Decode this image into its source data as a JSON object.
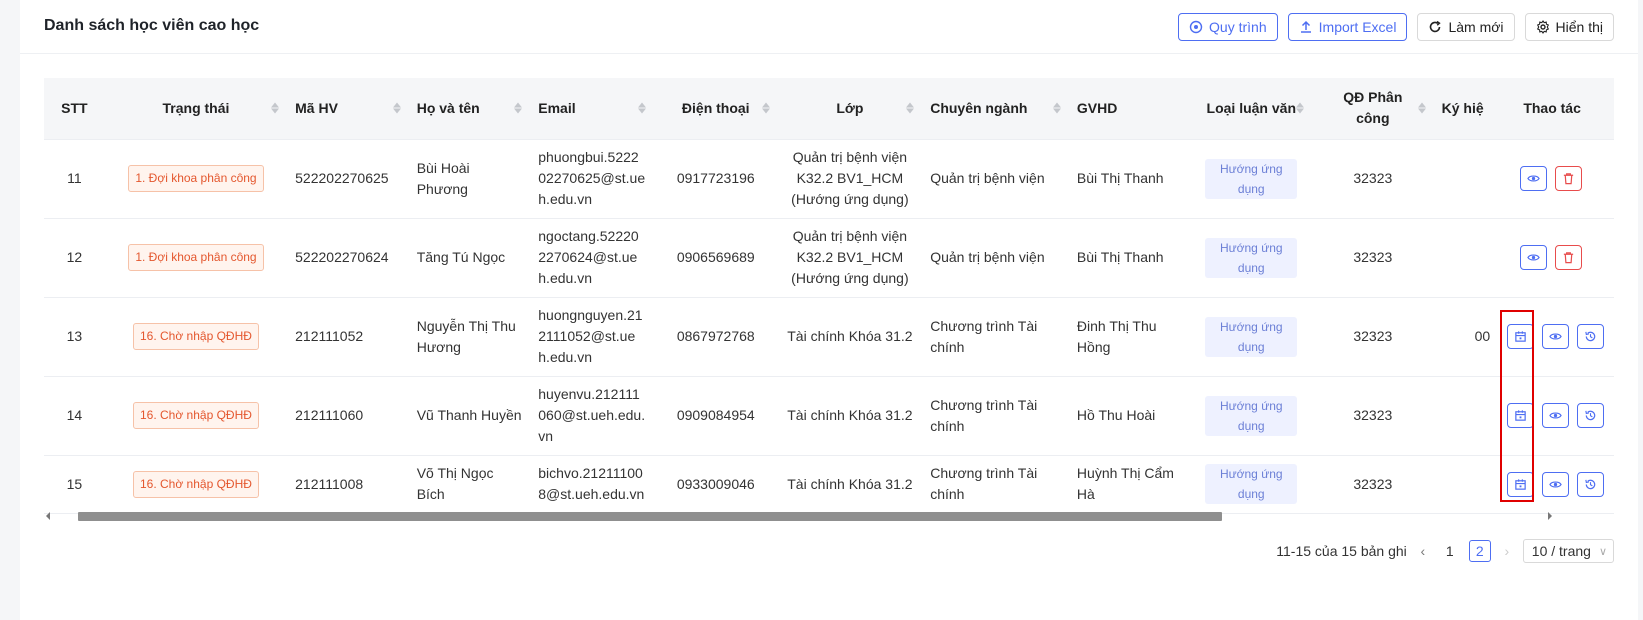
{
  "header": {
    "title": "Danh sách học viên cao học",
    "buttons": {
      "process": "Quy trình",
      "import": "Import Excel",
      "refresh": "Làm mới",
      "display": "Hiển thị"
    }
  },
  "table": {
    "columns": {
      "stt": "STT",
      "status": "Trạng thái",
      "student_id": "Mã HV",
      "name": "Họ và tên",
      "email": "Email",
      "phone": "Điện thoại",
      "class": "Lớp",
      "major": "Chuyên ngành",
      "advisor": "GVHD",
      "thesis_type": "Loại luận văn",
      "decision": "QĐ Phân công",
      "symbol": "Ký hiệ",
      "actions": "Thao tác"
    },
    "rows": [
      {
        "stt": "11",
        "status": "1. Đợi khoa phân công",
        "student_id": "522202270625",
        "name": "Bùi Hoài Phương",
        "email": "phuongbui.522202270625@st.ueh.edu.vn",
        "phone": "0917723196",
        "class": "Quản trị bệnh viện K32.2 BV1_HCM (Hướng ứng dụng)",
        "major": "Quản trị bệnh viện",
        "advisor": "Bùi Thị Thanh",
        "thesis_type": "Hướng ứng dụng",
        "decision": "32323",
        "symbol": "",
        "actions": [
          "view-icon",
          "delete-icon"
        ]
      },
      {
        "stt": "12",
        "status": "1. Đợi khoa phân công",
        "student_id": "522202270624",
        "name": "Tăng Tú Ngọc",
        "email": "ngoctang.522202270624@st.ueh.edu.vn",
        "phone": "0906569689",
        "class": "Quản trị bệnh viện K32.2 BV1_HCM (Hướng ứng dụng)",
        "major": "Quản trị bệnh viện",
        "advisor": "Bùi Thị Thanh",
        "thesis_type": "Hướng ứng dụng",
        "decision": "32323",
        "symbol": "",
        "actions": [
          "view-icon",
          "delete-icon"
        ]
      },
      {
        "stt": "13",
        "status": "16. Chờ nhập QĐHĐ",
        "student_id": "212111052",
        "name": "Nguyễn Thị Thu Hương",
        "email": "huongnguyen.212111052@st.ueh.edu.vn",
        "phone": "0867972768",
        "class": "Tài chính Khóa 31.2",
        "major": "Chương trình Tài chính",
        "advisor": "Đinh Thị Thu Hồng",
        "thesis_type": "Hướng ứng dụng",
        "decision": "32323",
        "symbol": "00",
        "actions": [
          "calendar-icon",
          "view-icon",
          "history-icon"
        ]
      },
      {
        "stt": "14",
        "status": "16. Chờ nhập QĐHĐ",
        "student_id": "212111060",
        "name": "Vũ Thanh Huyền",
        "email": "huyenvu.212111060@st.ueh.edu.vn",
        "phone": "0909084954",
        "class": "Tài chính Khóa 31.2",
        "major": "Chương trình Tài chính",
        "advisor": "Hồ Thu Hoài",
        "thesis_type": "Hướng ứng dụng",
        "decision": "32323",
        "symbol": "",
        "actions": [
          "calendar-icon",
          "view-icon",
          "history-icon"
        ]
      },
      {
        "stt": "15",
        "status": "16. Chờ nhập QĐHĐ",
        "student_id": "212111008",
        "name": "Võ Thị Ngọc Bích",
        "email": "bichvo.212111008@st.ueh.edu.vn",
        "phone": "0933009046",
        "class": "Tài chính Khóa 31.2",
        "major": "Chương trình Tài chính",
        "advisor": "Huỳnh Thị Cẩm Hà",
        "thesis_type": "Hướng ứng dụng",
        "decision": "32323",
        "symbol": "",
        "actions": [
          "calendar-icon",
          "view-icon",
          "history-icon"
        ]
      }
    ]
  },
  "pagination": {
    "summary": "11-15 của 15 bản ghi",
    "pages": [
      "1",
      "2"
    ],
    "current": "2",
    "page_size": "10 / trang"
  },
  "colors": {
    "primary": "#4e6ef2",
    "danger": "#e84c4c",
    "status": "#e4572e",
    "highlight": "#e00000"
  }
}
